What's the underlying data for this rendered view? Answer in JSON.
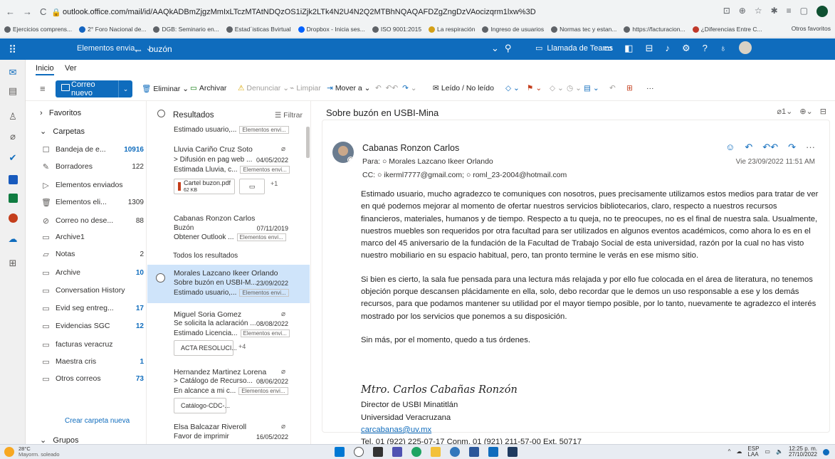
{
  "browser": {
    "url": "outlook.office.com/mail/id/AAQkADBmZjgzMmIxLTczMTAtNDQzOS1iZjk2LTk4N2U4N2Q2MTBhNQAQAFDZgZngDzVAocizqrm1lxw%3D",
    "bookmarks": [
      "Ejercicios comprens...",
      "2° Foro Nacional de...",
      "DGB: Seminario en...",
      "Estad´isticas Bvirtual",
      "Dropbox - Inicia ses...",
      "ISO 9001:2015",
      "La respiración",
      "Ingreso de usuarios",
      "Normas tec y estan...",
      "https://facturacion...",
      "¿Diferencias Entre C..."
    ],
    "other_bookmarks": "Otros favoritos"
  },
  "suite": {
    "scope": "Elementos envia...",
    "search_value": "buzón",
    "teams_label": "Llamada de Teams"
  },
  "tabs": [
    "Inicio",
    "Ver"
  ],
  "ribbon": {
    "new_mail": "Correo nuevo",
    "delete": "Eliminar",
    "archive": "Archivar",
    "report": "Denunciar",
    "sweep": "Limpiar",
    "move": "Mover a",
    "read_unread": "Leído / No leído"
  },
  "folders": {
    "favorites": "Favoritos",
    "folders_header": "Carpetas",
    "items": [
      {
        "name": "Bandeja de e...",
        "count": "10916",
        "blue": true,
        "icon": "inbox-icon",
        "glyph": "☐"
      },
      {
        "name": "Borradores",
        "count": "122",
        "blue": false,
        "icon": "drafts-icon",
        "glyph": "✎"
      },
      {
        "name": "Elementos enviados",
        "count": "",
        "blue": false,
        "icon": "sent-icon",
        "glyph": "▷"
      },
      {
        "name": "Elementos eli...",
        "count": "1309",
        "blue": false,
        "icon": "trash-icon",
        "glyph": "🗑"
      },
      {
        "name": "Correo no dese...",
        "count": "88",
        "blue": false,
        "icon": "junk-icon",
        "glyph": "⊘"
      },
      {
        "name": "Archive1",
        "count": "",
        "blue": false,
        "icon": "archive-icon",
        "glyph": "▭"
      },
      {
        "name": "Notas",
        "count": "2",
        "blue": false,
        "icon": "notes-icon",
        "glyph": "▱"
      },
      {
        "name": "Archive",
        "count": "10",
        "blue": true,
        "icon": "folder-icon",
        "glyph": "▭"
      },
      {
        "name": "Conversation History",
        "count": "",
        "blue": false,
        "icon": "folder-icon",
        "glyph": "▭"
      },
      {
        "name": "Evid seg entreg...",
        "count": "17",
        "blue": true,
        "icon": "folder-icon",
        "glyph": "▭"
      },
      {
        "name": "Evidencias SGC",
        "count": "12",
        "blue": true,
        "icon": "folder-icon",
        "glyph": "▭"
      },
      {
        "name": "facturas veracruz",
        "count": "",
        "blue": false,
        "icon": "folder-icon",
        "glyph": "▭"
      },
      {
        "name": "Maestra cris",
        "count": "1",
        "blue": true,
        "icon": "folder-icon",
        "glyph": "▭"
      },
      {
        "name": "Otros correos",
        "count": "73",
        "blue": true,
        "icon": "folder-icon",
        "glyph": "▭"
      }
    ],
    "new_folder": "Crear carpeta nueva",
    "groups": "Grupos"
  },
  "list": {
    "title": "Resultados",
    "filter": "Filtrar",
    "all_results": "Todos los resultados",
    "folder_chip": "Elementos envi...",
    "m0": {
      "preview": "Estimado usuario,..."
    },
    "m1": {
      "from": "Lluvia Cariño Cruz Soto",
      "subject": "> Difusión en pag web ...",
      "date": "04/05/2022",
      "preview": "Estimada Lluvia, c...",
      "attach": "Cartel buzon.pdf",
      "attach_size": "62 KB",
      "more": "+1"
    },
    "m2": {
      "from": "Cabanas Ronzon Carlos",
      "subject": "Buzón",
      "date": "07/11/2019",
      "preview": "Obtener Outlook ..."
    },
    "m3": {
      "from": "Morales Lazcano Ikeer Orlando",
      "subject": "Sobre buzón en USBI-M...",
      "date": "23/09/2022",
      "preview": "Estimado usuario,..."
    },
    "m4": {
      "from": "Miguel Soria Gomez",
      "subject": "Se solicita la aclaración ...",
      "date": "08/08/2022",
      "preview": "Estimado Licencia...",
      "attach": "ACTA RESOLUCI...",
      "more": "+4"
    },
    "m5": {
      "from": "Hernandez Martinez Lorena",
      "subject": "> Catálogo de Recurso...",
      "date": "08/06/2022",
      "preview": "En alcance a mi c...",
      "attach": "Catálogo-CDC-..."
    },
    "m6": {
      "from": "Elsa Balcazar Riveroll",
      "subject": "Favor de imprimir",
      "date": "16/05/2022"
    }
  },
  "reading": {
    "subject": "Sobre buzón en USBI-Mina",
    "sender": "Cabanas Ronzon Carlos",
    "to": "Para: ○ Morales Lazcano Ikeer Orlando",
    "cc": "CC: ○ ikerml7777@gmail.com; ○ roml_23-2004@hotmail.com",
    "date": "Vie 23/09/2022 11:51 AM",
    "p1": "Estimado usuario, mucho agradezco te comuniques con nosotros, pues precisamente utilizamos estos medios para tratar de ver en qué podemos mejorar al momento de ofertar nuestros servicios bibliotecarios, claro, respecto a nuestros recursos financieros, materiales, humanos y de tiempo. Respecto a tu queja, no te preocupes, no es el final de nuestra sala. Usualmente, nuestros muebles son requeridos por otra facultad para ser utilizados en algunos eventos académicos, como ahora lo es en el marco del 45 aniversario de la fundación de la Facultad de Trabajo Social de esta universidad, razón por la cual no has visto nuestro mobiliario en su espacio habitual, pero, tan pronto termine le verás en ese mismo sitio.",
    "p2": "Si bien es cierto, la sala fue pensada para una lectura más relajada y por ello fue colocada en el área de literatura, no tenemos objeción porque descansen plácidamente en ella, solo, debo recordar que le demos un uso responsable a ese y los demás recursos, para que podamos mantener su utilidad por el mayor tiempo posible, por lo tanto, nuevamente te agradezco el interés mostrado por los servicios que ponemos a su disposición.",
    "p3": "Sin más, por el momento, quedo a tus órdenes.",
    "sig_name": "Mtro. Carlos Cabañas Ronzón",
    "sig_title": "Director de USBI Minatitlán",
    "sig_org": "Universidad Veracruzana",
    "sig_email": "carcabanas@uv.mx",
    "sig_phone": "Tel. 01 (922) 225-07-17 Conm. 01 (921) 211-57-00 Ext. 50717"
  },
  "taskbar": {
    "temp": "28°C",
    "weather": "Mayorm. soleado",
    "lang": "ESP",
    "lang2": "LAA",
    "time": "12:25 p. m.",
    "date": "27/10/2022"
  },
  "colors": {
    "accent": "#0f6cbd",
    "selected": "#cfe4fa"
  }
}
